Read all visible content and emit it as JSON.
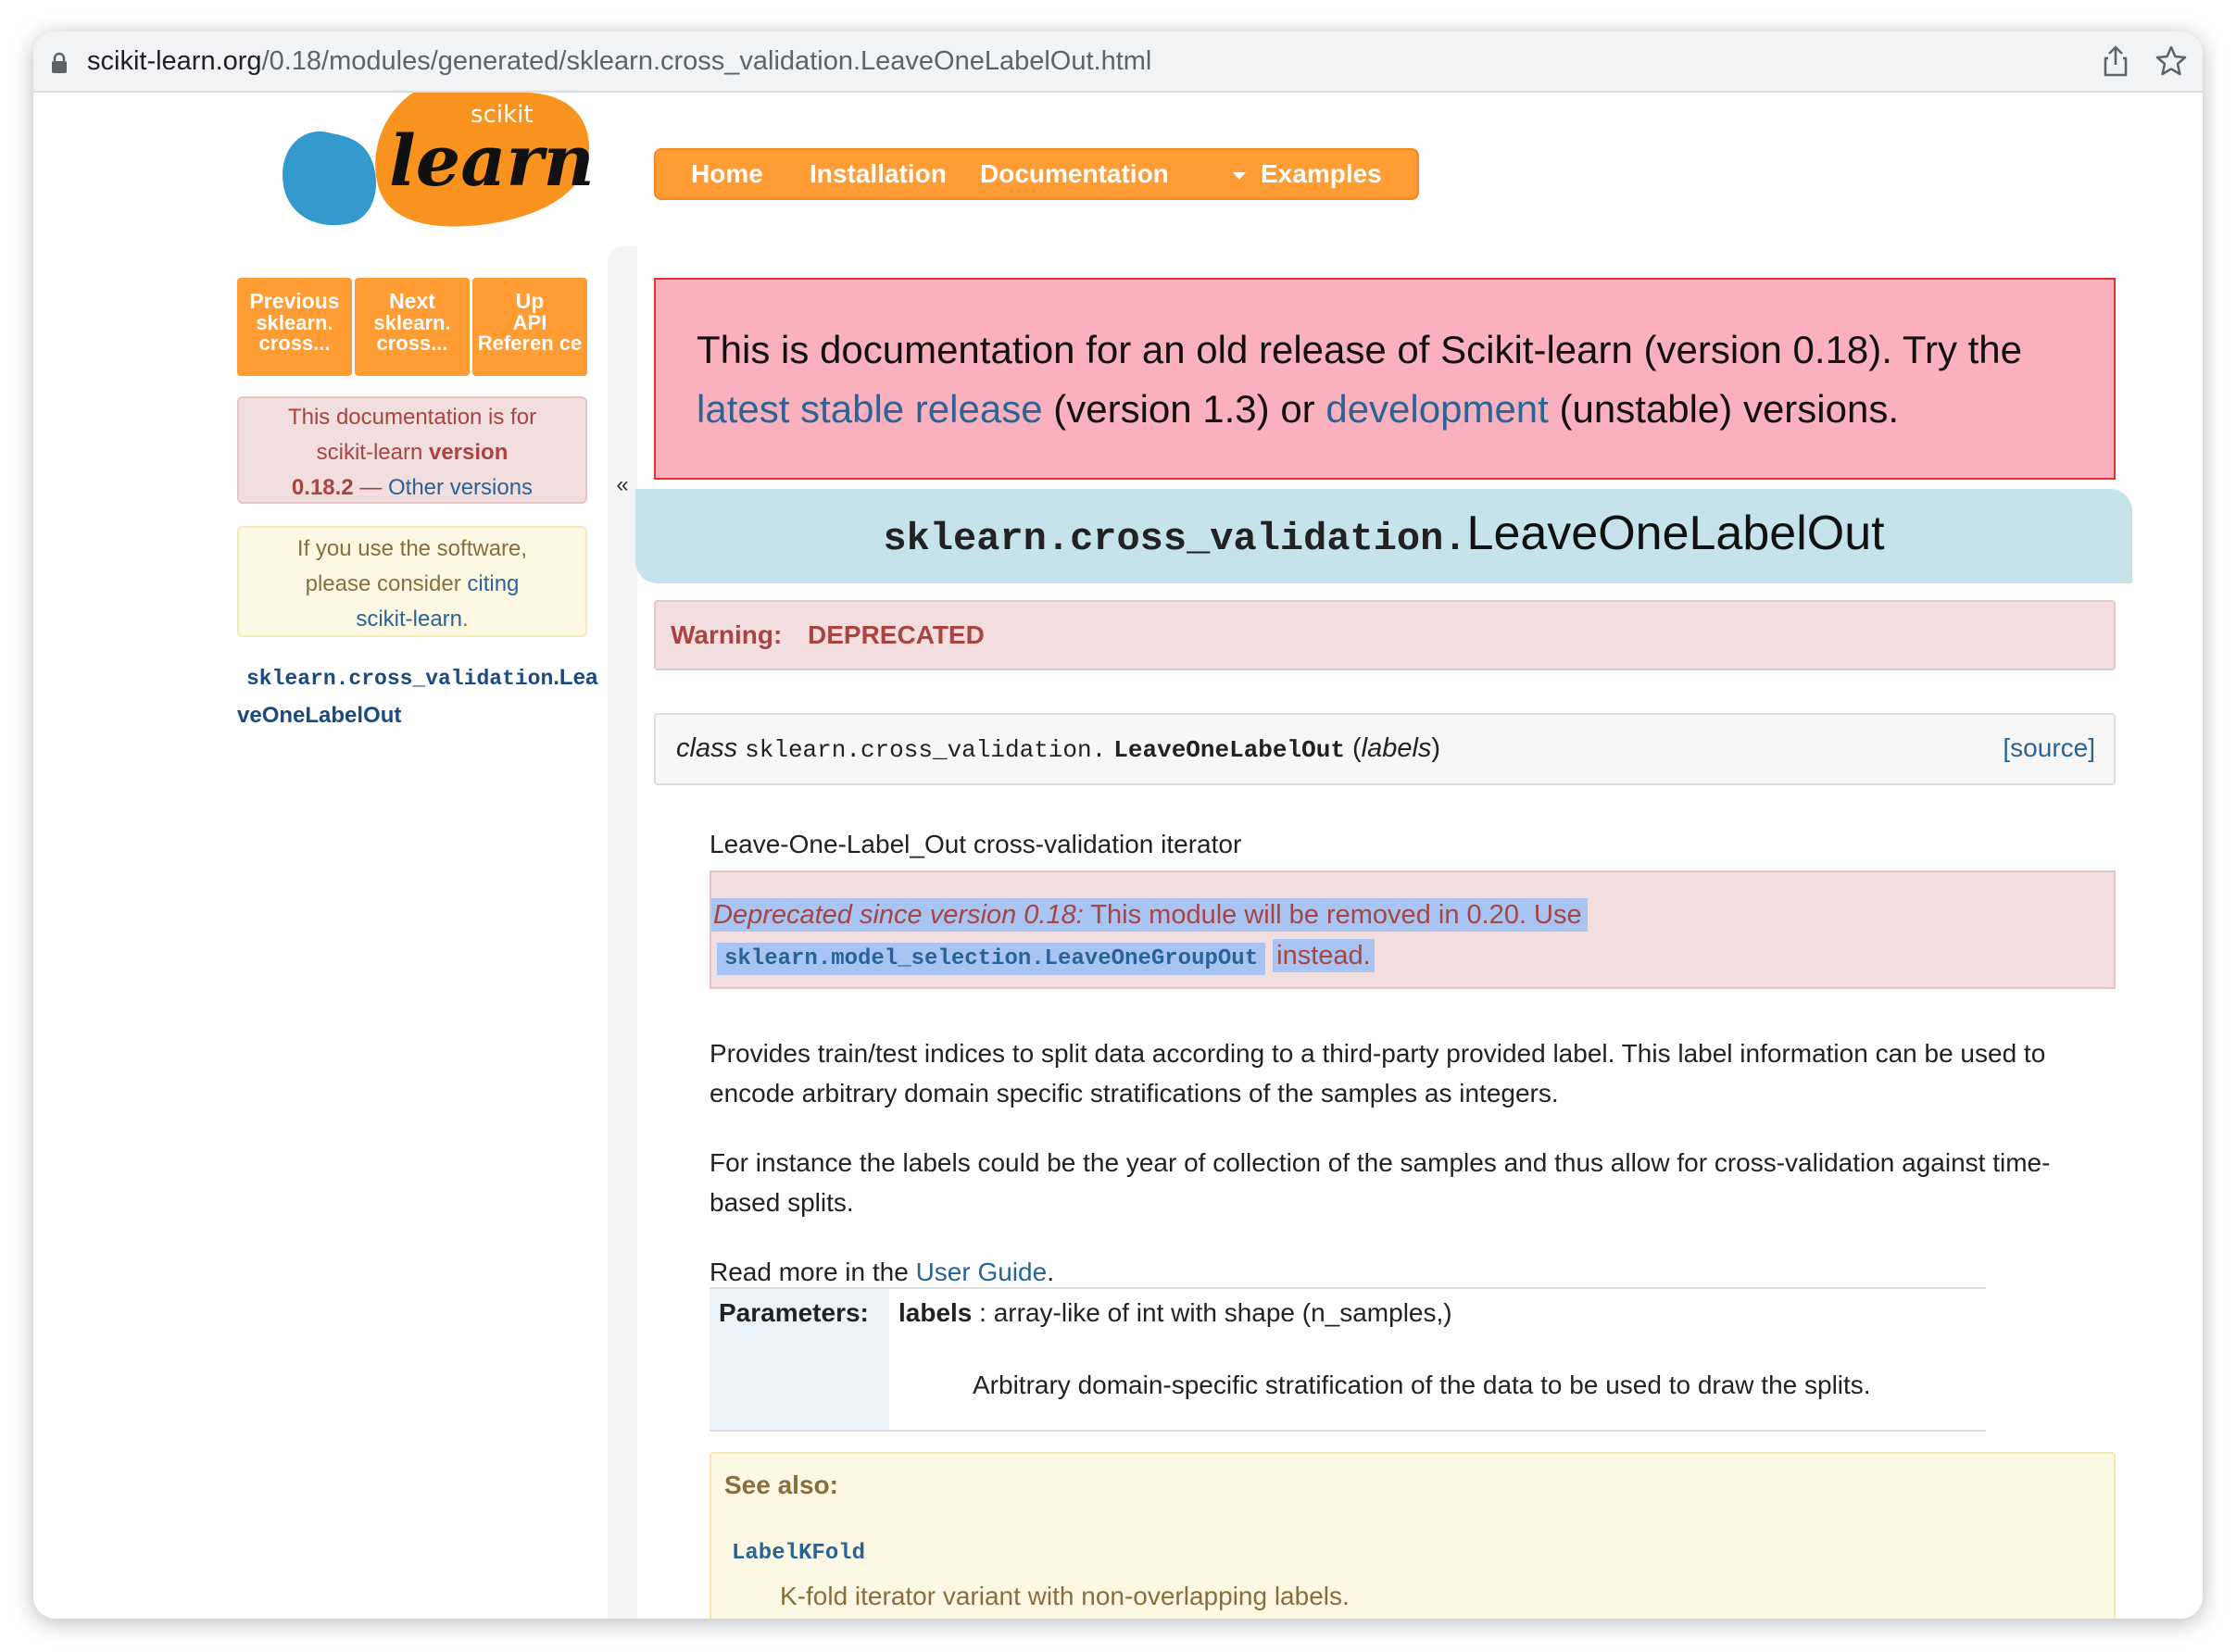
{
  "browser": {
    "url_host": "scikit-learn.org",
    "url_path": "/0.18/modules/generated/sklearn.cross_validation.LeaveOneLabelOut.html"
  },
  "logo": {
    "top_text": "scikit",
    "main_text": "learn"
  },
  "navbar": {
    "items": [
      "Home",
      "Installation",
      "Documentation",
      "Examples"
    ]
  },
  "sidebar": {
    "rel_nav": [
      {
        "label": "Previous",
        "sub": "sklearn. cross..."
      },
      {
        "label": "Next",
        "sub": "sklearn. cross..."
      },
      {
        "label": "Up",
        "sub": "API Referen ce"
      }
    ],
    "version_box": {
      "line1": "This documentation is for",
      "line2_pre": "scikit-learn ",
      "line2_bold": "version",
      "line3_bold": "0.18.2",
      "dash": " — ",
      "other_versions": "Other versions"
    },
    "cite_box": {
      "line1": "If you use the software,",
      "line2_pre": "please consider ",
      "line2_link": "citing",
      "line3_link": "scikit-learn",
      "line3_post": "."
    },
    "toc": {
      "mono": "sklearn.cross_validation",
      "rest": ".LeaveOneLabelOut"
    },
    "collapse": "«"
  },
  "banner": {
    "pre": "This is documentation for an old release of Scikit-learn (version 0.18). Try the ",
    "link1": "latest stable release",
    "mid": " (version 1.3) or ",
    "link2": "development",
    "post": " (unstable) versions."
  },
  "title": {
    "module": "sklearn.cross_validation.",
    "name": "LeaveOneLabelOut"
  },
  "warning": {
    "label": "Warning:",
    "text": "DEPRECATED"
  },
  "signature": {
    "keyword": "class",
    "module": "sklearn.cross_validation.",
    "name": "LeaveOneLabelOut",
    "open": " (",
    "param": "labels",
    "close": ")",
    "source": "[source]"
  },
  "description": "Leave-One-Label_Out cross-validation iterator",
  "deprecated": {
    "label": "Deprecated since version 0.18:",
    "text": " This module will be removed in 0.20. Use",
    "code": "sklearn.model_selection.LeaveOneGroupOut",
    "post": " instead."
  },
  "para1": "Provides train/test indices to split data according to a third-party provided label. This label information can be used to encode arbitrary domain specific stratifications of the samples as integers.",
  "para2": "For instance the labels could be the year of collection of the samples and thus allow for cross-validation against time-based splits.",
  "para3": {
    "pre": "Read more in the ",
    "link": "User Guide",
    "post": "."
  },
  "params": {
    "header": "Parameters:",
    "name": "labels",
    "type": " : array-like of int with shape (n_samples,)",
    "desc": "Arbitrary domain-specific stratification of the data to be used to draw the splits."
  },
  "see_also": {
    "title": "See also:",
    "code": "LabelKFold",
    "desc": "K-fold iterator variant with non-overlapping labels."
  },
  "colors": {
    "orange": "#ff9c34",
    "link": "#2a6496",
    "danger": "#a94442",
    "selection": "#a8c4f2",
    "title_bg": "#c6e2ea"
  }
}
